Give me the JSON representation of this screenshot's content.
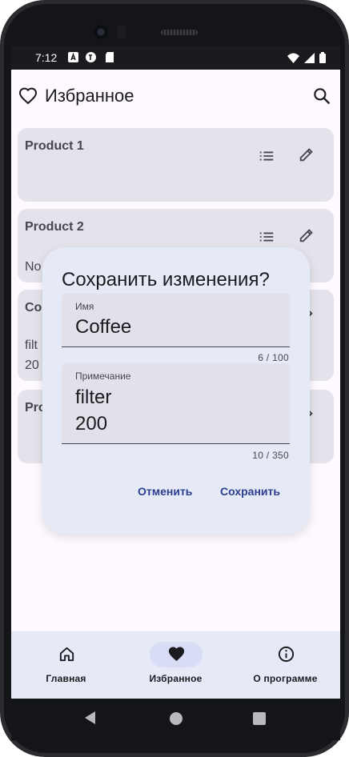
{
  "status_bar": {
    "time": "7:12"
  },
  "app_bar": {
    "title": "Избранное"
  },
  "cards": [
    {
      "title": "Product 1",
      "note_lines": []
    },
    {
      "title": "Product 2",
      "note_lines": [
        "No"
      ]
    },
    {
      "title": "Co",
      "note_lines": [
        "filt",
        "20"
      ]
    },
    {
      "title": "Pro",
      "note_lines": []
    }
  ],
  "dialog": {
    "title": "Сохранить изменения?",
    "name_field": {
      "label": "Имя",
      "value": "Coffee",
      "counter": "6 / 100"
    },
    "note_field": {
      "label": "Примечание",
      "value_lines": [
        "filter",
        "200"
      ],
      "counter": "10 / 350"
    },
    "cancel_label": "Отменить",
    "save_label": "Сохранить"
  },
  "nav": {
    "items": [
      {
        "label": "Главная",
        "icon": "home-icon",
        "active": false
      },
      {
        "label": "Избранное",
        "icon": "heart-icon",
        "active": true
      },
      {
        "label": "О программе",
        "icon": "info-icon",
        "active": false
      }
    ]
  },
  "colors": {
    "accent": "#2b3f8f",
    "card_bg": "#e4e2ea",
    "dialog_bg": "#e6eaf7",
    "nav_indicator": "#d8ddf5"
  }
}
